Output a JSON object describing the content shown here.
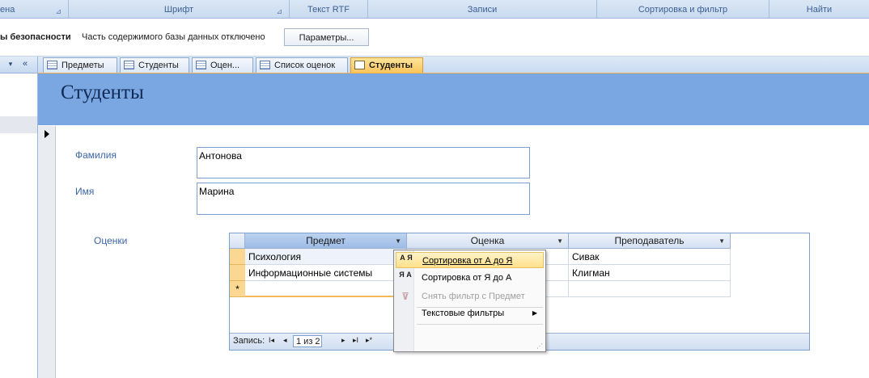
{
  "ribbon": {
    "groups": [
      {
        "label": "ена",
        "launcher": true
      },
      {
        "label": "Шрифт",
        "launcher": true
      },
      {
        "label": "Текст RTF",
        "launcher": false
      },
      {
        "label": "Записи",
        "launcher": false
      },
      {
        "label": "Сортировка и фильтр",
        "launcher": false
      },
      {
        "label": "Найти",
        "launcher": false
      }
    ]
  },
  "message_bar": {
    "warning_label": "ы безопасности",
    "message": "Часть содержимого базы данных отключено",
    "options_button": "Параметры..."
  },
  "nav_pane": {
    "dropdown_glyph": "▾",
    "shutter_glyph": "«"
  },
  "tabs": [
    {
      "label": "Предметы",
      "active": false
    },
    {
      "label": "Студенты",
      "active": false
    },
    {
      "label": "Оцен...",
      "active": false
    },
    {
      "label": "Список оценок",
      "active": false
    },
    {
      "label": "Студенты",
      "active": true
    }
  ],
  "form": {
    "title": "Студенты",
    "fields": {
      "surname": {
        "label": "Фамилия",
        "value": "Антонова"
      },
      "name": {
        "label": "Имя",
        "value": "Марина"
      }
    },
    "subform_label": "Оценки"
  },
  "subform": {
    "columns": [
      "Предмет",
      "Оценка",
      "Преподаватель"
    ],
    "rows": [
      [
        "Психология",
        "",
        "Сивак"
      ],
      [
        "Информационные системы",
        "",
        "Клигман"
      ]
    ],
    "new_row_marker": "*",
    "navigation": {
      "label": "Запись:",
      "current": "1 из 2",
      "first": "I◂",
      "prev": "◂",
      "next": "▸",
      "last": "▸I",
      "new": "▸*"
    }
  },
  "context_menu": {
    "items": [
      {
        "label": "Сортировка от А до Я",
        "icon_text": "А Я",
        "state": "highlighted"
      },
      {
        "label": "Сортировка от Я до А",
        "icon_text": "Я А",
        "state": "normal"
      },
      {
        "label": "Снять фильтр с Предмет",
        "icon_text": "",
        "state": "disabled"
      },
      {
        "label": "Текстовые фильтры",
        "icon_text": "",
        "state": "submenu"
      }
    ]
  }
}
